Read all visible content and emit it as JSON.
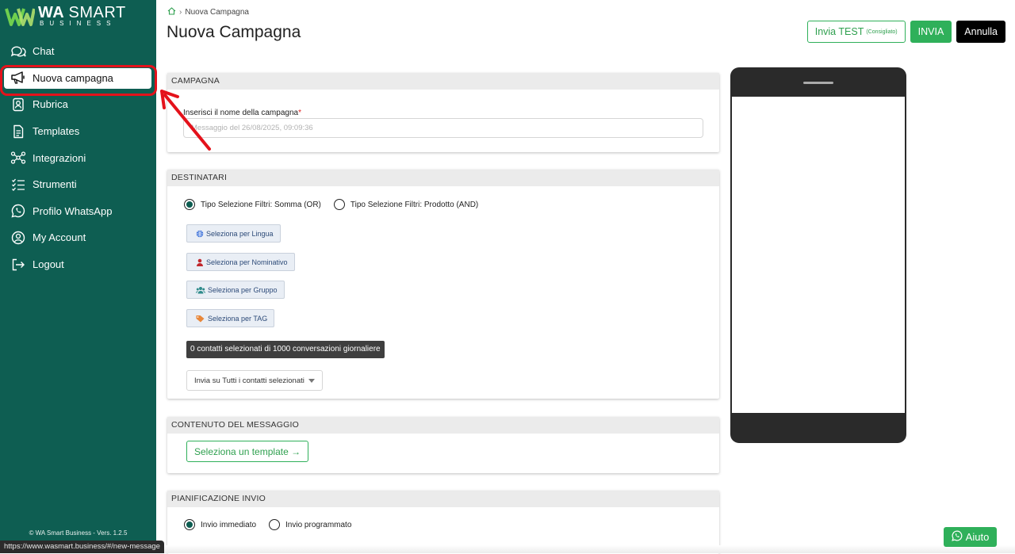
{
  "logo": {
    "title_bold": "WA",
    "title_thin": "SMART",
    "subtitle": "BUSINESS"
  },
  "sidebar": {
    "items": [
      {
        "label": "Chat",
        "icon": "chat-icon"
      },
      {
        "label": "Nuova campagna",
        "icon": "megaphone-icon",
        "active": true
      },
      {
        "label": "Rubrica",
        "icon": "contact-book-icon"
      },
      {
        "label": "Templates",
        "icon": "document-icon"
      },
      {
        "label": "Integrazioni",
        "icon": "integration-icon"
      },
      {
        "label": "Strumenti",
        "icon": "checklist-icon"
      },
      {
        "label": "Profilo WhatsApp",
        "icon": "whatsapp-icon"
      },
      {
        "label": "My Account",
        "icon": "user-circle-icon"
      },
      {
        "label": "Logout",
        "icon": "logout-icon"
      }
    ],
    "copyright": "© WA Smart Business - Vers. 1.2.5"
  },
  "status_url": "https://www.wasmart.business/#/new-message",
  "breadcrumb": {
    "current": "Nuova Campagna"
  },
  "page_title": "Nuova Campagna",
  "actions": {
    "test_label": "Invia TEST",
    "test_note": "(Consigliato)",
    "send_label": "INVIA",
    "cancel_label": "Annulla"
  },
  "campagna": {
    "header": "CAMPAGNA",
    "name_label": "Inserisci il nome della campagna",
    "required_mark": "*",
    "name_placeholder": "Messaggio del 26/08/2025, 09:09:36"
  },
  "destinatari": {
    "header": "DESTINATARI",
    "filter_or": "Tipo Selezione Filtri: Somma (OR)",
    "filter_and": "Tipo Selezione Filtri: Prodotto (AND)",
    "btn_lingua": "Seleziona per Lingua",
    "btn_nominativo": "Seleziona per Nominativo",
    "btn_gruppo": "Seleziona per Gruppo",
    "btn_tag": "Seleziona per TAG",
    "counter": "0 contatti selezionati di 1000 conversazioni giornaliere",
    "send_target": "Invia su Tutti i contatti selezionati"
  },
  "contenuto": {
    "header": "CONTENUTO DEL MESSAGGIO",
    "template_btn": "Seleziona un template →"
  },
  "pianificazione": {
    "header": "PIANIFICAZIONE INVIO",
    "immediate": "Invio immediato",
    "scheduled": "Invio programmato"
  },
  "help_label": "Aiuto",
  "colors": {
    "sidebar": "#0e5e52",
    "accent": "#2fb05a",
    "highlight": "#e4121b"
  }
}
